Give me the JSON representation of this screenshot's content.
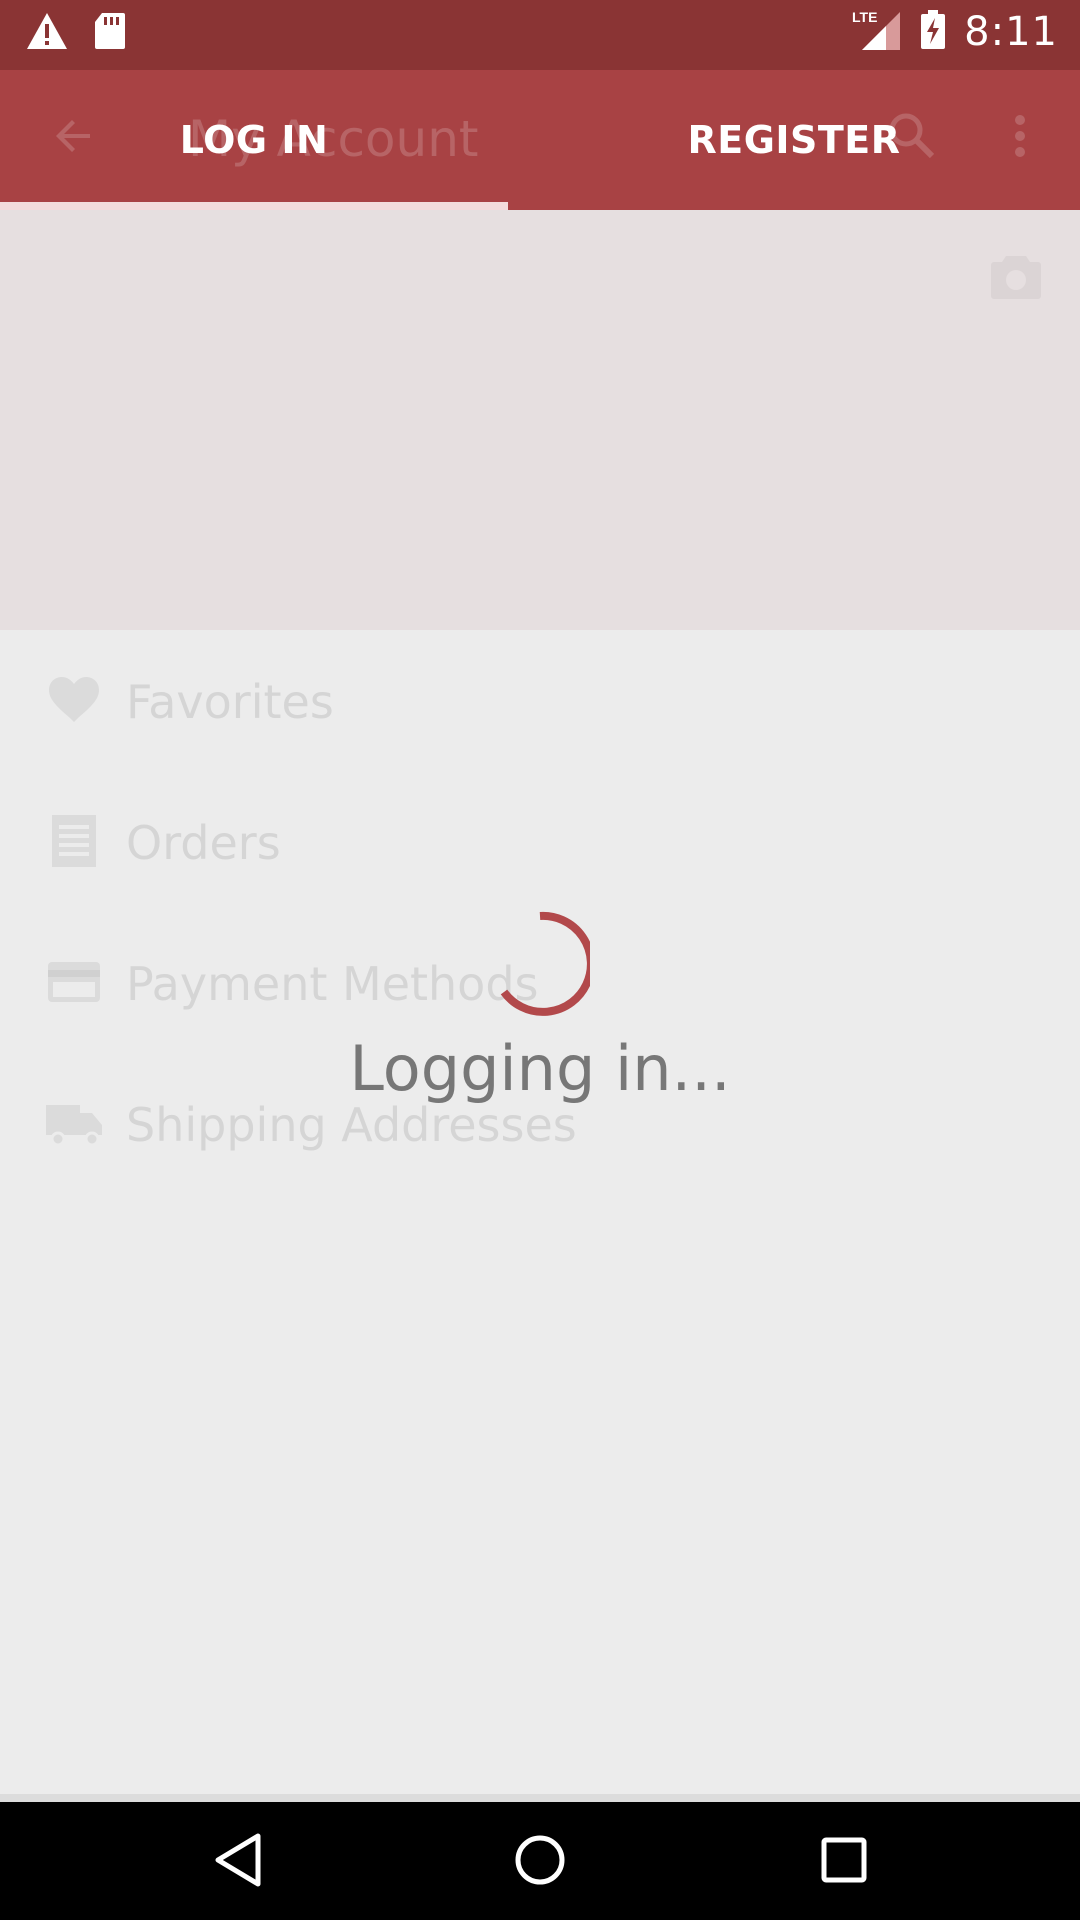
{
  "status_bar": {
    "time": "8:11",
    "network": "LTE",
    "icons": [
      "warning-icon",
      "sd-card-icon",
      "signal-icon",
      "battery-charging-icon"
    ]
  },
  "app_bar": {
    "title": "My Account",
    "tabs": [
      {
        "label": "LOG IN",
        "selected": true
      },
      {
        "label": "REGISTER",
        "selected": false
      }
    ]
  },
  "menu": {
    "items": [
      {
        "label": "Favorites",
        "icon": "heart-icon"
      },
      {
        "label": "Orders",
        "icon": "receipt-icon"
      },
      {
        "label": "Payment Methods",
        "icon": "credit-card-icon"
      },
      {
        "label": "Shipping Addresses",
        "icon": "truck-icon"
      }
    ]
  },
  "loading": {
    "message": "Logging in..."
  },
  "colors": {
    "primary": "#a84244",
    "status_bar": "#8a3434",
    "spinner": "#b2494b"
  }
}
